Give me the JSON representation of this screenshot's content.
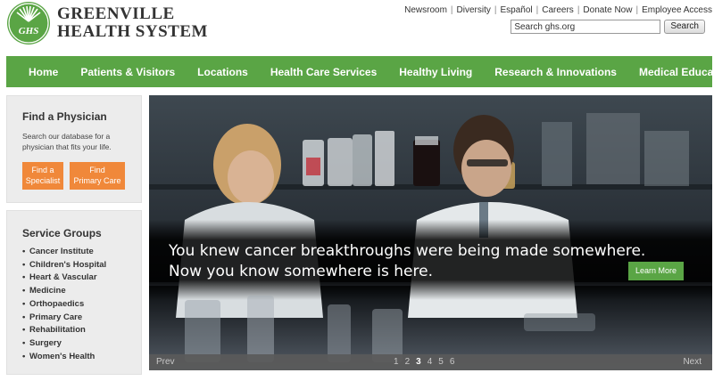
{
  "header": {
    "logo_mark": "GHS",
    "logo_line1": "GREENVILLE",
    "logo_line2": "HEALTH SYSTEM",
    "utility_links": [
      "Newsroom",
      "Diversity",
      "Español",
      "Careers",
      "Donate Now",
      "Employee Access"
    ],
    "search_value": "Search ghs.org",
    "search_button": "Search"
  },
  "nav": {
    "items": [
      "Home",
      "Patients & Visitors",
      "Locations",
      "Health Care Services",
      "Healthy Living",
      "Research & Innovations",
      "Medical Education"
    ]
  },
  "find_physician": {
    "title": "Find a Physician",
    "description": "Search our database for a physician that fits your life.",
    "button1_line1": "Find a",
    "button1_line2": "Specialist",
    "button2_line1": "Find",
    "button2_line2": "Primary Care"
  },
  "service_groups": {
    "title": "Service Groups",
    "items": [
      "Cancer Institute",
      "Children's Hospital",
      "Heart & Vascular",
      "Medicine",
      "Orthopaedics",
      "Primary Care",
      "Rehabilitation",
      "Surgery",
      "Women's Health"
    ]
  },
  "hero": {
    "caption_line1": "You knew cancer breakthroughs were being made somewhere.",
    "caption_line2": "Now you know somewhere is here.",
    "learn_more": "Learn More",
    "prev": "Prev",
    "next": "Next",
    "pages": [
      "1",
      "2",
      "3",
      "4",
      "5",
      "6"
    ],
    "active_page": "3"
  },
  "colors": {
    "brand_green": "#5aa545",
    "accent_orange": "#f0883a"
  }
}
